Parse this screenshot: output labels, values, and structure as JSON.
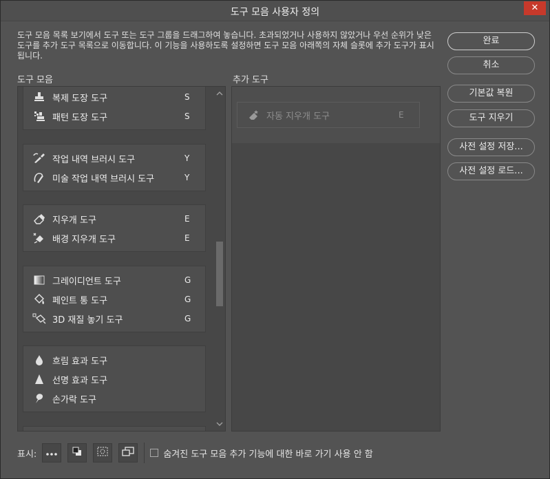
{
  "window": {
    "title": "도구 모음 사용자 정의",
    "close_label": "✕"
  },
  "description": "도구 모음 목록 보기에서 도구 또는 도구 그룹을 드래그하여 놓습니다. 초과되었거나 사용하지 않았거나 우선 순위가 낮은 도구를 추가 도구 목록으로 이동합니다. 이 기능을 사용하도록 설정하면 도구 모음 아래쪽의 자체 슬롯에 추가 도구가 표시됩니다.",
  "buttons": {
    "ok": "완료",
    "cancel": "취소",
    "restore_defaults": "기본값 복원",
    "clear_tools": "도구 지우기",
    "save_preset": "사전 설정 저장...",
    "load_preset": "사전 설정 로드..."
  },
  "toolbar_section": {
    "label": "도구 모음",
    "groups": [
      {
        "tools": [
          {
            "name": "복제 도장 도구",
            "key": "S",
            "icon": "clone-stamp-icon"
          },
          {
            "name": "패턴 도장 도구",
            "key": "S",
            "icon": "pattern-stamp-icon"
          }
        ]
      },
      {
        "tools": [
          {
            "name": "작업 내역 브러시 도구",
            "key": "Y",
            "icon": "history-brush-icon"
          },
          {
            "name": "미술 작업 내역 브러시 도구",
            "key": "Y",
            "icon": "art-history-brush-icon"
          }
        ]
      },
      {
        "tools": [
          {
            "name": "지우개 도구",
            "key": "E",
            "icon": "eraser-icon"
          },
          {
            "name": "배경 지우개 도구",
            "key": "E",
            "icon": "background-eraser-icon"
          }
        ]
      },
      {
        "tools": [
          {
            "name": "그레이디언트 도구",
            "key": "G",
            "icon": "gradient-icon"
          },
          {
            "name": "페인트 통 도구",
            "key": "G",
            "icon": "paint-bucket-icon"
          },
          {
            "name": "3D 재질 놓기 도구",
            "key": "G",
            "icon": "3d-material-drop-icon"
          }
        ]
      },
      {
        "tools": [
          {
            "name": "흐림 효과 도구",
            "key": "",
            "icon": "blur-icon"
          },
          {
            "name": "선명 효과 도구",
            "key": "",
            "icon": "sharpen-icon"
          },
          {
            "name": "손가락 도구",
            "key": "",
            "icon": "smudge-icon"
          }
        ]
      }
    ]
  },
  "extra_section": {
    "label": "추가 도구",
    "tools": [
      {
        "name": "자동 지우개 도구",
        "key": "E",
        "icon": "magic-eraser-icon"
      }
    ]
  },
  "bottom": {
    "show_label": "표시:",
    "icons": [
      "more-icon",
      "foreground-background-icon",
      "quick-mask-icon",
      "screen-mode-icon"
    ],
    "checkbox_label": "숨겨진 도구 모음 추가 기능에 대한 바로 가기 사용 안 함",
    "checkbox_checked": false
  },
  "colors": {
    "background": "#535353",
    "panel": "#474747",
    "close_button": "#c7392b"
  }
}
